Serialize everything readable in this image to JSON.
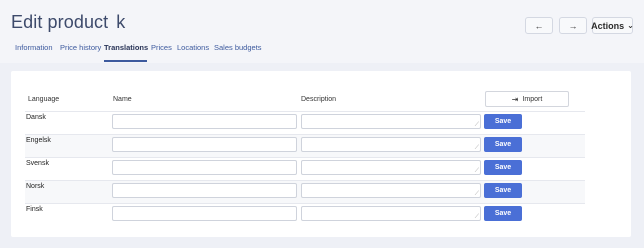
{
  "header": {
    "title": "Edit product",
    "title_suffix": "k",
    "prev_label": "←",
    "next_label": "→",
    "actions_label": "Actions"
  },
  "tabs": [
    {
      "label": "Information"
    },
    {
      "label": "Price history"
    },
    {
      "label": "Translations",
      "active": true
    },
    {
      "label": "Prices"
    },
    {
      "label": "Locations"
    },
    {
      "label": "Sales budgets"
    }
  ],
  "table": {
    "columns": {
      "language": "Language",
      "name": "Name",
      "description": "Description"
    },
    "import_label": "Import",
    "rows": [
      {
        "language": "Dansk",
        "name": "",
        "description": "",
        "save_label": "Save"
      },
      {
        "language": "Engelsk",
        "name": "",
        "description": "",
        "save_label": "Save"
      },
      {
        "language": "Svensk",
        "name": "",
        "description": "",
        "save_label": "Save"
      },
      {
        "language": "Norsk",
        "name": "",
        "description": "",
        "save_label": "Save"
      },
      {
        "language": "Finsk",
        "name": "",
        "description": "",
        "save_label": "Save"
      }
    ]
  },
  "colors": {
    "accent": "#4a6fd6",
    "tab_text": "#3d5a9e",
    "title_text": "#3d4a6b"
  }
}
